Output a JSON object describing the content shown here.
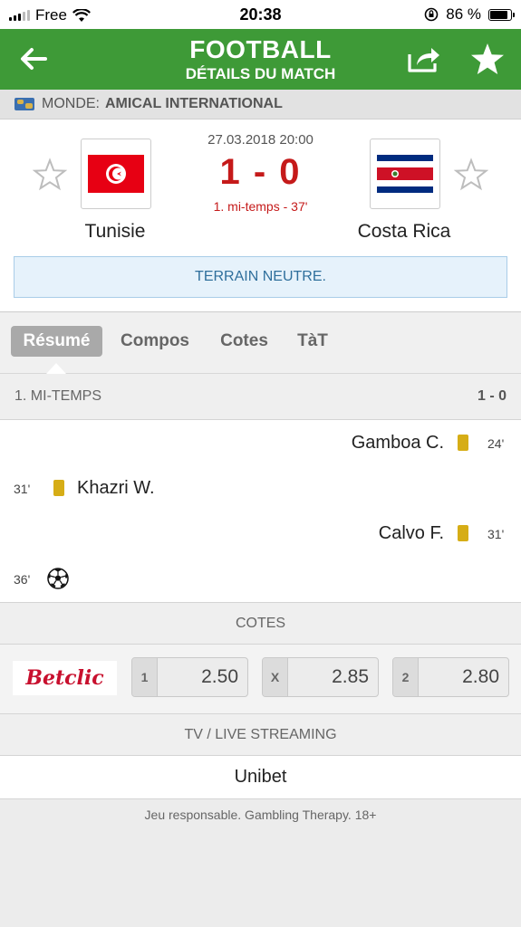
{
  "status_bar": {
    "carrier": "Free",
    "time": "20:38",
    "battery": "86 %",
    "battery_level": 0.86
  },
  "header": {
    "title": "FOOTBALL",
    "subtitle": "DÉTAILS DU MATCH",
    "icons": [
      "back-arrow-icon",
      "share-icon",
      "star-icon"
    ]
  },
  "league": {
    "region": "MONDE:",
    "name": "AMICAL INTERNATIONAL"
  },
  "match": {
    "date": "27.03.2018 20:00",
    "score": "1 - 0",
    "status": "1. mi-temps - 37'",
    "home": {
      "name": "Tunisie",
      "flag": "tunisia-flag"
    },
    "away": {
      "name": "Costa Rica",
      "flag": "costa-rica-flag"
    },
    "venue_note": "TERRAIN NEUTRE."
  },
  "tabs": [
    {
      "label": "Résumé",
      "active": true
    },
    {
      "label": "Compos",
      "active": false
    },
    {
      "label": "Cotes",
      "active": false
    },
    {
      "label": "TàT",
      "active": false
    }
  ],
  "summary": {
    "period_label": "1. MI-TEMPS",
    "period_score": "1 - 0",
    "events": [
      {
        "side": "away",
        "minute": "24'",
        "player": "Gamboa C.",
        "type": "yellow-card"
      },
      {
        "side": "home",
        "minute": "31'",
        "player": "Khazri W.",
        "type": "yellow-card"
      },
      {
        "side": "away",
        "minute": "31'",
        "player": "Calvo F.",
        "type": "yellow-card"
      },
      {
        "side": "home",
        "minute": "36'",
        "player": "",
        "type": "goal"
      }
    ]
  },
  "odds": {
    "section_label": "COTES",
    "bookmaker": "Betclic",
    "items": [
      {
        "key": "1",
        "value": "2.50"
      },
      {
        "key": "X",
        "value": "2.85"
      },
      {
        "key": "2",
        "value": "2.80"
      }
    ]
  },
  "tv": {
    "section_label": "TV / LIVE STREAMING",
    "provider": "Unibet"
  },
  "footer": {
    "note": "Jeu responsable. Gambling Therapy. 18+"
  },
  "colors": {
    "header_green": "#3e9a37",
    "score_red": "#c51a1a",
    "yellow_card": "#d6ad16",
    "neutral_blue": "#2f6f9c"
  }
}
